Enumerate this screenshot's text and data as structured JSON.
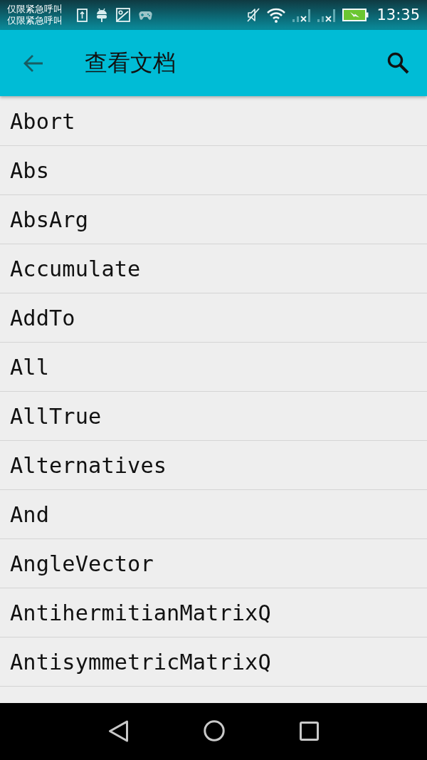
{
  "status_bar": {
    "notices": [
      "仅限紧急呼叫",
      "仅限紧急呼叫"
    ],
    "time": "13:35"
  },
  "app_bar": {
    "title": "查看文档"
  },
  "list": {
    "items": [
      "Abort",
      "Abs",
      "AbsArg",
      "Accumulate",
      "AddTo",
      "All",
      "AllTrue",
      "Alternatives",
      "And",
      "AngleVector",
      "AntihermitianMatrixQ",
      "AntisymmetricMatrixQ"
    ]
  }
}
